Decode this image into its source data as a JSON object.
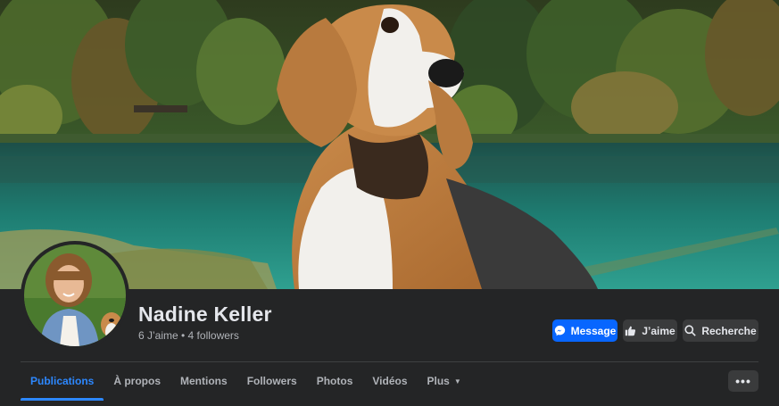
{
  "profile": {
    "name": "Nadine Keller",
    "stats": "6 J’aime • 4 followers"
  },
  "actions": {
    "message_label": "Message",
    "like_label": "J’aime",
    "search_label": "Recherche"
  },
  "tabs": [
    {
      "label": "Publications",
      "active": true
    },
    {
      "label": "À propos",
      "active": false
    },
    {
      "label": "Mentions",
      "active": false
    },
    {
      "label": "Followers",
      "active": false
    },
    {
      "label": "Photos",
      "active": false
    },
    {
      "label": "Vidéos",
      "active": false
    },
    {
      "label": "Plus",
      "active": false
    }
  ],
  "icons": {
    "message": "messenger-icon",
    "like": "thumbs-up-icon",
    "search": "search-icon",
    "more": "more-dots-icon",
    "plus_caret": "caret-down-icon"
  },
  "colors": {
    "background": "#242526",
    "accent": "#0866ff",
    "active_tab": "#2d88ff",
    "button_secondary": "#3a3b3c"
  }
}
